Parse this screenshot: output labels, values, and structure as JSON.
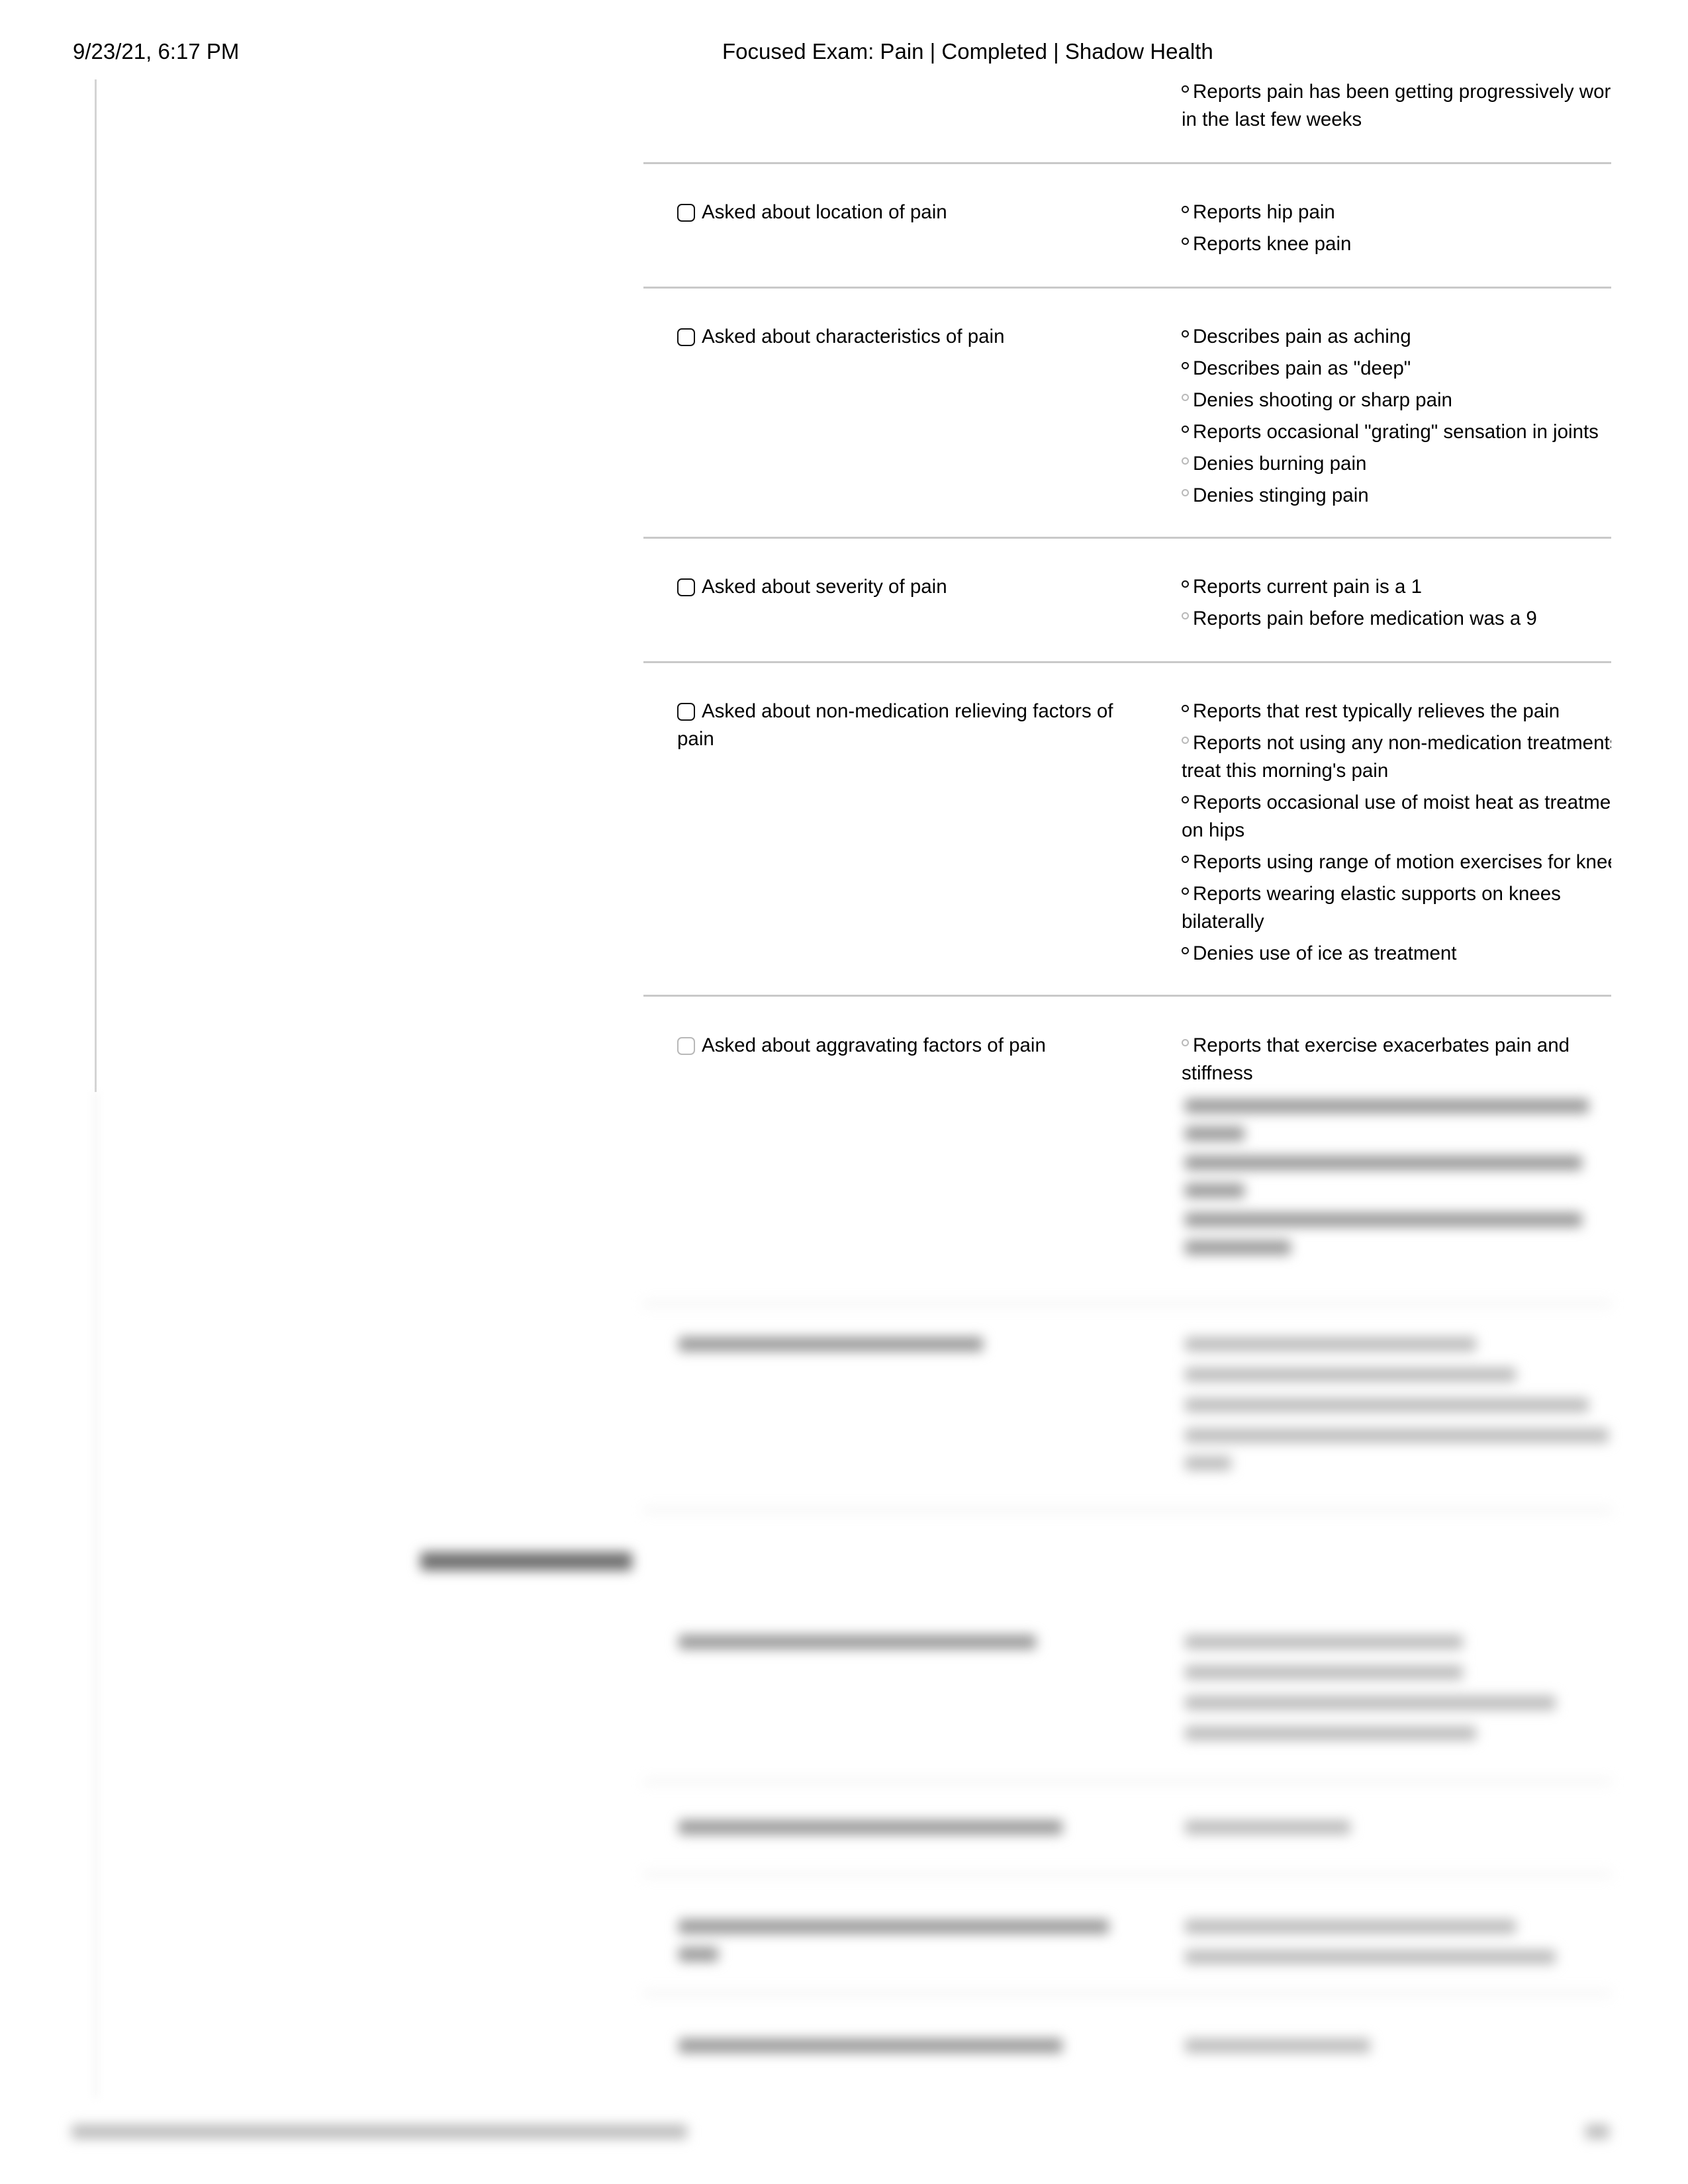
{
  "header": {
    "datetime": "9/23/21, 6:17 PM",
    "page_title": "Focused Exam: Pain | Completed | Shadow Health"
  },
  "continued_findings": [
    {
      "text": "Reports pain has been getting progressively worse in the last few weeks",
      "emphasis": "dark"
    }
  ],
  "items": [
    {
      "question": "Asked about location of pain",
      "checkbox_style": "dark",
      "findings": [
        {
          "text": "Reports hip pain",
          "emphasis": "dark"
        },
        {
          "text": "Reports knee pain",
          "emphasis": "dark"
        }
      ]
    },
    {
      "question": "Asked about characteristics of pain",
      "checkbox_style": "dark",
      "findings": [
        {
          "text": "Describes pain as aching",
          "emphasis": "dark"
        },
        {
          "text": "Describes pain as \"deep\"",
          "emphasis": "dark"
        },
        {
          "text": "Denies shooting or sharp pain",
          "emphasis": "light"
        },
        {
          "text": "Reports occasional \"grating\" sensation in joints",
          "emphasis": "dark"
        },
        {
          "text": "Denies burning pain",
          "emphasis": "light"
        },
        {
          "text": "Denies stinging pain",
          "emphasis": "light"
        }
      ]
    },
    {
      "question": "Asked about severity of pain",
      "checkbox_style": "dark",
      "findings": [
        {
          "text": "Reports current pain is a 1",
          "emphasis": "dark"
        },
        {
          "text": "Reports pain before medication was a 9",
          "emphasis": "light"
        }
      ]
    },
    {
      "question": "Asked about non-medication relieving factors of pain",
      "checkbox_style": "dark",
      "findings": [
        {
          "text": "Reports that rest typically relieves the pain",
          "emphasis": "dark"
        },
        {
          "text": "Reports not using any non-medication treatments to treat this morning's pain",
          "emphasis": "light"
        },
        {
          "text": "Reports occasional use of moist heat as treatment on hips",
          "emphasis": "dark"
        },
        {
          "text": "Reports using range of motion exercises for knees",
          "emphasis": "dark"
        },
        {
          "text": "Reports wearing elastic supports on knees bilaterally",
          "emphasis": "dark"
        },
        {
          "text": "Denies use of ice as treatment",
          "emphasis": "dark"
        }
      ]
    },
    {
      "question": "Asked about aggravating factors of pain",
      "checkbox_style": "light",
      "findings": [
        {
          "text": "Reports that exercise exacerbates pain and stiffness",
          "emphasis": "light"
        }
      ]
    }
  ],
  "blurred_section_note": "Remaining content below is blurred and illegible"
}
